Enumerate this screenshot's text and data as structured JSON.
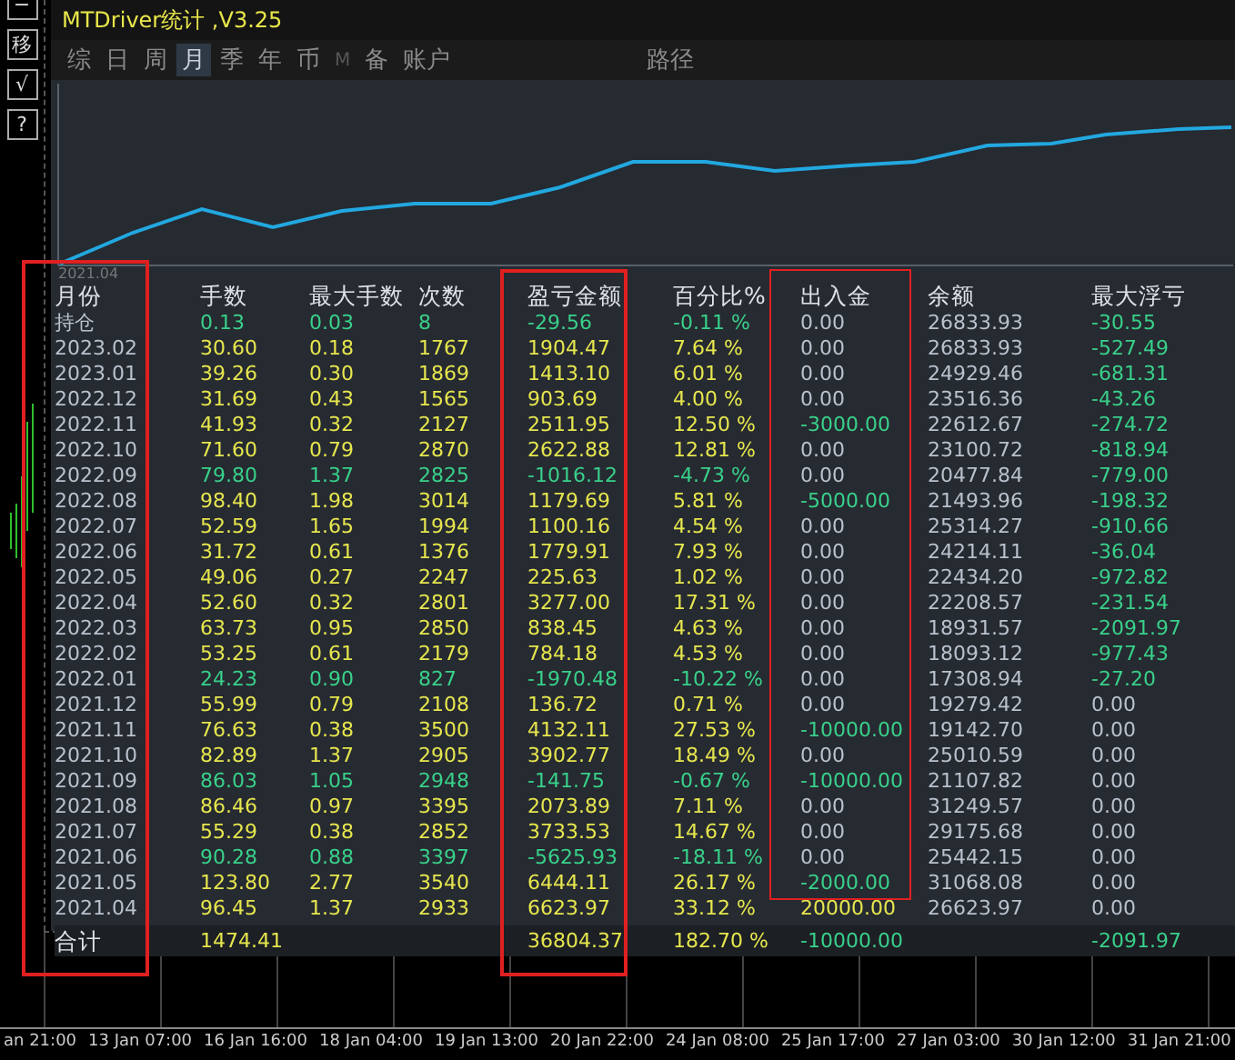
{
  "tool_buttons": [
    "−",
    "移",
    "√",
    "?"
  ],
  "window": {
    "title": "MTDriver统计 ,V3.25"
  },
  "tabs": [
    {
      "label": "综",
      "selected": false,
      "disabled": false
    },
    {
      "label": "日",
      "selected": false,
      "disabled": false
    },
    {
      "label": "周",
      "selected": false,
      "disabled": false
    },
    {
      "label": "月",
      "selected": true,
      "disabled": false
    },
    {
      "label": "季",
      "selected": false,
      "disabled": false
    },
    {
      "label": "年",
      "selected": false,
      "disabled": false
    },
    {
      "label": "币",
      "selected": false,
      "disabled": false
    },
    {
      "label": "M",
      "selected": false,
      "disabled": true
    },
    {
      "label": "备",
      "selected": false,
      "disabled": false
    },
    {
      "label": "账户",
      "selected": false,
      "disabled": false
    }
  ],
  "path_button": "路径",
  "equity_chart": {
    "start_label": "2021.04"
  },
  "table": {
    "columns": [
      "月份",
      "手数",
      "最大手数",
      "次数",
      "盈亏金额",
      "百分比%",
      "出入金",
      "余额",
      "最大浮亏"
    ],
    "rows": [
      {
        "month": "持仓",
        "lots": "0.13",
        "max_lots": "0.03",
        "trades": "8",
        "pnl": "-29.56",
        "percent": "-0.11 %",
        "cash": "0.00",
        "balance": "26833.93",
        "drawdown": "-30.55",
        "loss": true,
        "cash_out": false,
        "cash_in": false,
        "has_drawdown": true
      },
      {
        "month": "2023.02",
        "lots": "30.60",
        "max_lots": "0.18",
        "trades": "1767",
        "pnl": "1904.47",
        "percent": "7.64 %",
        "cash": "0.00",
        "balance": "26833.93",
        "drawdown": "-527.49",
        "loss": false,
        "cash_out": false,
        "cash_in": false,
        "has_drawdown": true
      },
      {
        "month": "2023.01",
        "lots": "39.26",
        "max_lots": "0.30",
        "trades": "1869",
        "pnl": "1413.10",
        "percent": "6.01 %",
        "cash": "0.00",
        "balance": "24929.46",
        "drawdown": "-681.31",
        "loss": false,
        "cash_out": false,
        "cash_in": false,
        "has_drawdown": true
      },
      {
        "month": "2022.12",
        "lots": "31.69",
        "max_lots": "0.43",
        "trades": "1565",
        "pnl": "903.69",
        "percent": "4.00 %",
        "cash": "0.00",
        "balance": "23516.36",
        "drawdown": "-43.26",
        "loss": false,
        "cash_out": false,
        "cash_in": false,
        "has_drawdown": true
      },
      {
        "month": "2022.11",
        "lots": "41.93",
        "max_lots": "0.32",
        "trades": "2127",
        "pnl": "2511.95",
        "percent": "12.50 %",
        "cash": "-3000.00",
        "balance": "22612.67",
        "drawdown": "-274.72",
        "loss": false,
        "cash_out": true,
        "cash_in": false,
        "has_drawdown": true
      },
      {
        "month": "2022.10",
        "lots": "71.60",
        "max_lots": "0.79",
        "trades": "2870",
        "pnl": "2622.88",
        "percent": "12.81 %",
        "cash": "0.00",
        "balance": "23100.72",
        "drawdown": "-818.94",
        "loss": false,
        "cash_out": false,
        "cash_in": false,
        "has_drawdown": true
      },
      {
        "month": "2022.09",
        "lots": "79.80",
        "max_lots": "1.37",
        "trades": "2825",
        "pnl": "-1016.12",
        "percent": "-4.73 %",
        "cash": "0.00",
        "balance": "20477.84",
        "drawdown": "-779.00",
        "loss": true,
        "cash_out": false,
        "cash_in": false,
        "has_drawdown": true
      },
      {
        "month": "2022.08",
        "lots": "98.40",
        "max_lots": "1.98",
        "trades": "3014",
        "pnl": "1179.69",
        "percent": "5.81 %",
        "cash": "-5000.00",
        "balance": "21493.96",
        "drawdown": "-198.32",
        "loss": false,
        "cash_out": true,
        "cash_in": false,
        "has_drawdown": true
      },
      {
        "month": "2022.07",
        "lots": "52.59",
        "max_lots": "1.65",
        "trades": "1994",
        "pnl": "1100.16",
        "percent": "4.54 %",
        "cash": "0.00",
        "balance": "25314.27",
        "drawdown": "-910.66",
        "loss": false,
        "cash_out": false,
        "cash_in": false,
        "has_drawdown": true
      },
      {
        "month": "2022.06",
        "lots": "31.72",
        "max_lots": "0.61",
        "trades": "1376",
        "pnl": "1779.91",
        "percent": "7.93 %",
        "cash": "0.00",
        "balance": "24214.11",
        "drawdown": "-36.04",
        "loss": false,
        "cash_out": false,
        "cash_in": false,
        "has_drawdown": true
      },
      {
        "month": "2022.05",
        "lots": "49.06",
        "max_lots": "0.27",
        "trades": "2247",
        "pnl": "225.63",
        "percent": "1.02 %",
        "cash": "0.00",
        "balance": "22434.20",
        "drawdown": "-972.82",
        "loss": false,
        "cash_out": false,
        "cash_in": false,
        "has_drawdown": true
      },
      {
        "month": "2022.04",
        "lots": "52.60",
        "max_lots": "0.32",
        "trades": "2801",
        "pnl": "3277.00",
        "percent": "17.31 %",
        "cash": "0.00",
        "balance": "22208.57",
        "drawdown": "-231.54",
        "loss": false,
        "cash_out": false,
        "cash_in": false,
        "has_drawdown": true
      },
      {
        "month": "2022.03",
        "lots": "63.73",
        "max_lots": "0.95",
        "trades": "2850",
        "pnl": "838.45",
        "percent": "4.63 %",
        "cash": "0.00",
        "balance": "18931.57",
        "drawdown": "-2091.97",
        "loss": false,
        "cash_out": false,
        "cash_in": false,
        "has_drawdown": true
      },
      {
        "month": "2022.02",
        "lots": "53.25",
        "max_lots": "0.61",
        "trades": "2179",
        "pnl": "784.18",
        "percent": "4.53 %",
        "cash": "0.00",
        "balance": "18093.12",
        "drawdown": "-977.43",
        "loss": false,
        "cash_out": false,
        "cash_in": false,
        "has_drawdown": true
      },
      {
        "month": "2022.01",
        "lots": "24.23",
        "max_lots": "0.90",
        "trades": "827",
        "pnl": "-1970.48",
        "percent": "-10.22 %",
        "cash": "0.00",
        "balance": "17308.94",
        "drawdown": "-27.20",
        "loss": true,
        "cash_out": false,
        "cash_in": false,
        "has_drawdown": true
      },
      {
        "month": "2021.12",
        "lots": "55.99",
        "max_lots": "0.79",
        "trades": "2108",
        "pnl": "136.72",
        "percent": "0.71 %",
        "cash": "0.00",
        "balance": "19279.42",
        "drawdown": "0.00",
        "loss": false,
        "cash_out": false,
        "cash_in": false,
        "has_drawdown": false
      },
      {
        "month": "2021.11",
        "lots": "76.63",
        "max_lots": "0.38",
        "trades": "3500",
        "pnl": "4132.11",
        "percent": "27.53 %",
        "cash": "-10000.00",
        "balance": "19142.70",
        "drawdown": "0.00",
        "loss": false,
        "cash_out": true,
        "cash_in": false,
        "has_drawdown": false
      },
      {
        "month": "2021.10",
        "lots": "82.89",
        "max_lots": "1.37",
        "trades": "2905",
        "pnl": "3902.77",
        "percent": "18.49 %",
        "cash": "0.00",
        "balance": "25010.59",
        "drawdown": "0.00",
        "loss": false,
        "cash_out": false,
        "cash_in": false,
        "has_drawdown": false
      },
      {
        "month": "2021.09",
        "lots": "86.03",
        "max_lots": "1.05",
        "trades": "2948",
        "pnl": "-141.75",
        "percent": "-0.67 %",
        "cash": "-10000.00",
        "balance": "21107.82",
        "drawdown": "0.00",
        "loss": true,
        "cash_out": true,
        "cash_in": false,
        "has_drawdown": false
      },
      {
        "month": "2021.08",
        "lots": "86.46",
        "max_lots": "0.97",
        "trades": "3395",
        "pnl": "2073.89",
        "percent": "7.11 %",
        "cash": "0.00",
        "balance": "31249.57",
        "drawdown": "0.00",
        "loss": false,
        "cash_out": false,
        "cash_in": false,
        "has_drawdown": false
      },
      {
        "month": "2021.07",
        "lots": "55.29",
        "max_lots": "0.38",
        "trades": "2852",
        "pnl": "3733.53",
        "percent": "14.67 %",
        "cash": "0.00",
        "balance": "29175.68",
        "drawdown": "0.00",
        "loss": false,
        "cash_out": false,
        "cash_in": false,
        "has_drawdown": false
      },
      {
        "month": "2021.06",
        "lots": "90.28",
        "max_lots": "0.88",
        "trades": "3397",
        "pnl": "-5625.93",
        "percent": "-18.11 %",
        "cash": "0.00",
        "balance": "25442.15",
        "drawdown": "0.00",
        "loss": true,
        "cash_out": false,
        "cash_in": false,
        "has_drawdown": false
      },
      {
        "month": "2021.05",
        "lots": "123.80",
        "max_lots": "2.77",
        "trades": "3540",
        "pnl": "6444.11",
        "percent": "26.17 %",
        "cash": "-2000.00",
        "balance": "31068.08",
        "drawdown": "0.00",
        "loss": false,
        "cash_out": true,
        "cash_in": false,
        "has_drawdown": false
      },
      {
        "month": "2021.04",
        "lots": "96.45",
        "max_lots": "1.37",
        "trades": "2933",
        "pnl": "6623.97",
        "percent": "33.12 %",
        "cash": "20000.00",
        "balance": "26623.97",
        "drawdown": "0.00",
        "loss": false,
        "cash_out": false,
        "cash_in": true,
        "has_drawdown": false
      }
    ],
    "total": {
      "label": "合计",
      "lots": "1474.41",
      "pnl": "36804.37",
      "percent": "182.70 %",
      "cash": "-10000.00",
      "drawdown": "-2091.97",
      "loss": false,
      "cash_out": true,
      "cash_in": false,
      "has_drawdown": true
    }
  },
  "time_axis": [
    "an 21:00",
    "13 Jan 07:00",
    "16 Jan 16:00",
    "18 Jan 04:00",
    "19 Jan 13:00",
    "20 Jan 22:00",
    "24 Jan 08:00",
    "25 Jan 17:00",
    "27 Jan 03:00",
    "30 Jan 12:00",
    "31 Jan 21:00"
  ]
}
